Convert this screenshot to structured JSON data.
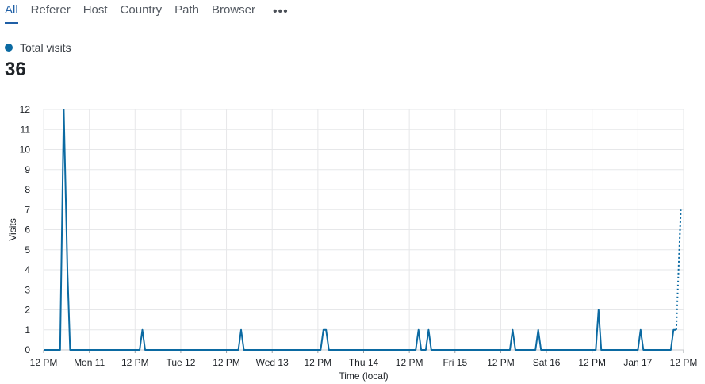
{
  "tabs": [
    {
      "label": "All",
      "active": true
    },
    {
      "label": "Referer",
      "active": false
    },
    {
      "label": "Host",
      "active": false
    },
    {
      "label": "Country",
      "active": false
    },
    {
      "label": "Path",
      "active": false
    },
    {
      "label": "Browser",
      "active": false
    }
  ],
  "more_icon": "more-horizontal-icon",
  "summary": {
    "legend_label": "Total visits",
    "total": "36"
  },
  "colors": {
    "series": "#0b6aa2",
    "grid": "#e6e7e9",
    "active_tab": "#1f5fa6"
  },
  "chart_data": {
    "type": "line",
    "xlabel": "Time (local)",
    "ylabel": "Visits",
    "ylim": [
      0,
      12
    ],
    "y_ticks": [
      0,
      1,
      2,
      3,
      4,
      5,
      6,
      7,
      8,
      9,
      10,
      11,
      12
    ],
    "xlim": [
      0,
      6
    ],
    "x_unit": "days since first tick (12 PM)",
    "x_ticks": [
      {
        "x": 0,
        "label": "12 PM"
      },
      {
        "x": 0.5,
        "label": "Mon 11"
      },
      {
        "x": 1,
        "label": "12 PM"
      },
      {
        "x": 1.5,
        "label": "Tue 12"
      },
      {
        "x": 2,
        "label": "12 PM"
      },
      {
        "x": 2.5,
        "label": "Wed 13"
      },
      {
        "x": 3,
        "label": "12 PM"
      },
      {
        "x": 3.5,
        "label": "Thu 14"
      },
      {
        "x": 4,
        "label": "12 PM"
      },
      {
        "x": 4.5,
        "label": "Fri 15"
      },
      {
        "x": 5,
        "label": "12 PM"
      },
      {
        "x": 5.5,
        "label": "Sat 16"
      },
      {
        "x": 6,
        "label": "12 PM"
      },
      {
        "x": 6.5,
        "label": "Jan 17"
      },
      {
        "x": 7,
        "label": "12 PM"
      }
    ],
    "grid": true,
    "series": [
      {
        "name": "Total visits",
        "points": [
          [
            0.0,
            0
          ],
          [
            0.18,
            0
          ],
          [
            0.22,
            12
          ],
          [
            0.26,
            4
          ],
          [
            0.29,
            0
          ],
          [
            1.05,
            0
          ],
          [
            1.08,
            1
          ],
          [
            1.11,
            0
          ],
          [
            2.13,
            0
          ],
          [
            2.16,
            1
          ],
          [
            2.19,
            0
          ],
          [
            3.03,
            0
          ],
          [
            3.06,
            1
          ],
          [
            3.09,
            1
          ],
          [
            3.12,
            0
          ],
          [
            4.07,
            0
          ],
          [
            4.1,
            1
          ],
          [
            4.13,
            0
          ],
          [
            4.18,
            0
          ],
          [
            4.21,
            1
          ],
          [
            4.24,
            0
          ],
          [
            5.1,
            0
          ],
          [
            5.13,
            1
          ],
          [
            5.16,
            0
          ],
          [
            5.38,
            0
          ],
          [
            5.41,
            1
          ],
          [
            5.44,
            0
          ],
          [
            6.04,
            0
          ],
          [
            6.07,
            2
          ],
          [
            6.1,
            0
          ],
          [
            6.5,
            0
          ],
          [
            6.53,
            1
          ],
          [
            6.56,
            0
          ],
          [
            6.86,
            0
          ],
          [
            6.89,
            1
          ],
          [
            6.92,
            1
          ]
        ],
        "projected": [
          [
            6.92,
            1
          ],
          [
            6.97,
            7
          ]
        ]
      }
    ]
  }
}
